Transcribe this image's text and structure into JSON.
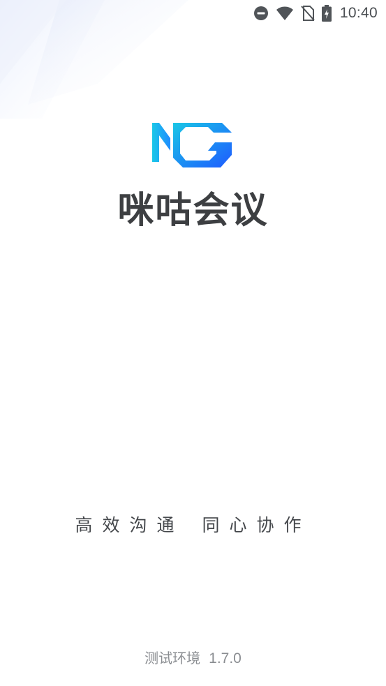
{
  "status_bar": {
    "time": "10:40",
    "icons": [
      "do-not-disturb-icon",
      "wifi-icon",
      "no-sim-icon",
      "battery-charging-icon"
    ]
  },
  "splash": {
    "logo_icon": "migu-meeting-logo-icon",
    "app_name": "咪咕会议",
    "slogan_part1": "高效沟通",
    "slogan_part2": "同心协作",
    "environment": "测试环境",
    "version": "1.7.0"
  },
  "colors": {
    "logo_gradient_start": "#19C6E6",
    "logo_gradient_end": "#1E5BFF",
    "title_text": "#3D3F42",
    "slogan_text": "#44474B",
    "footer_text": "#8A8D91",
    "status_icons": "#505458"
  }
}
